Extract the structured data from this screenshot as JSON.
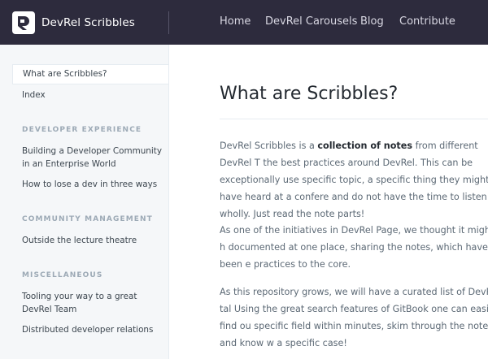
{
  "header": {
    "brand": "DevRel Scribbles",
    "nav": [
      "Home",
      "DevRel Carousels",
      "Blog",
      "Contribute"
    ]
  },
  "sidebar": {
    "active": "What are Scribbles?",
    "index": "Index",
    "sections": [
      {
        "heading": "DEVELOPER EXPERIENCE",
        "items": [
          "Building a Developer Community in an Enterprise World",
          "How to lose a dev in three ways"
        ]
      },
      {
        "heading": "COMMUNITY MANAGEMENT",
        "items": [
          "Outside the lecture theatre"
        ]
      },
      {
        "heading": "MISCELLANEOUS",
        "items": [
          "Tooling your way to a great DevRel Team",
          "Distributed developer relations"
        ]
      }
    ]
  },
  "content": {
    "title": "What are Scribbles?",
    "p1_pre": "DevRel Scribbles is a ",
    "p1_bold": "collection of notes",
    "p1_post": " from different DevRel T the best practices around DevRel. This can be exceptionally use specific topic, a specific thing they might have heard at a confere and do not have the time to listen to it wholly. Just read the note parts!",
    "p2": "As one of the initiatives in DevRel Page, we thought it might be h documented at one place, sharing the notes, which have been e practices to the core.",
    "p3": "As this repository grows, we will have a curated list of DevRel tal Using the great search features of GitBook one can easily find ou specific field within minutes, skim through the notes and know w a specific case!"
  },
  "colors": {
    "topbar": "#2d2b3d",
    "sidebar": "#f5f7f9",
    "heading": "#9daab6",
    "text": "#5c6975"
  }
}
